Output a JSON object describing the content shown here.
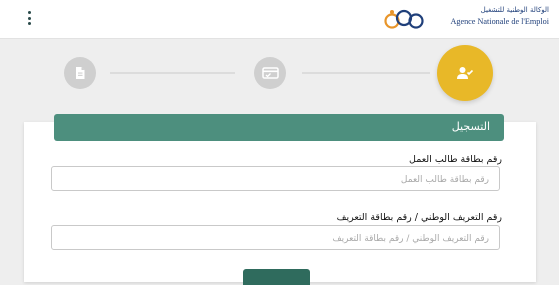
{
  "header": {
    "logo_arabic": "الوكالة الوطنية للتشغيل",
    "logo_french": "Agence Nationale de l'Emploi"
  },
  "stepper": {
    "steps": [
      {
        "icon": "document-icon",
        "state": "inactive"
      },
      {
        "icon": "card-check-icon",
        "state": "inactive"
      },
      {
        "icon": "user-check-icon",
        "state": "active"
      }
    ]
  },
  "form": {
    "title": "التسجيل",
    "job_card": {
      "label": "رقم بطاقة طالب العمل",
      "placeholder": "رقم بطاقة طالب العمل",
      "value": ""
    },
    "national_id": {
      "label": "رقم التعريف الوطني / رقم بطاقة التعريف",
      "placeholder": "رقم التعريف الوطني / رقم بطاقة التعريف",
      "value": ""
    }
  },
  "colors": {
    "header_green": "#4d8f7e",
    "active_step": "#e8b828",
    "inactive_step": "#cfcfcf",
    "button": "#2f6b5d"
  }
}
